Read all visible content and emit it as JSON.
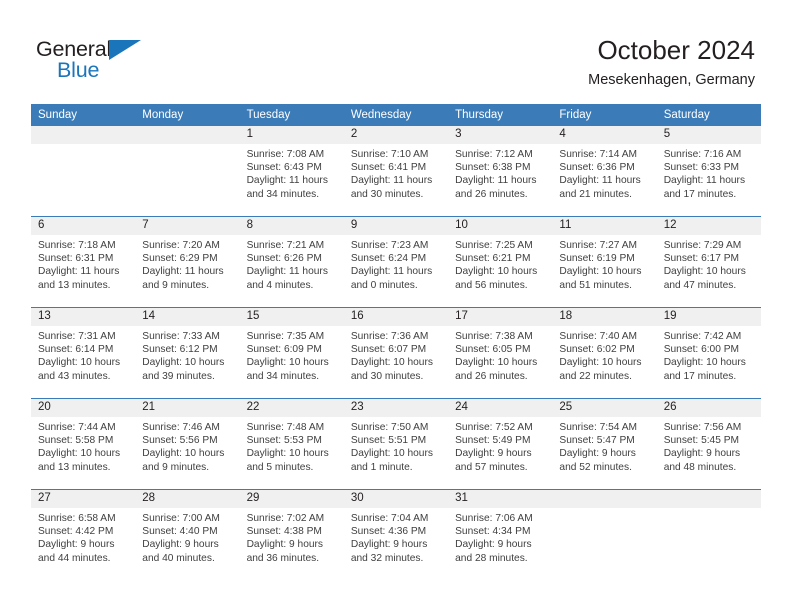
{
  "brand": {
    "line1": "General",
    "line2": "Blue",
    "triangle_icon": "blue-triangle-logo-mark",
    "color_dark": "#231f20",
    "color_blue": "#1b75bb"
  },
  "header": {
    "title": "October 2024",
    "subtitle": "Mesekenhagen, Germany"
  },
  "theme": {
    "header_bg": "#3b7cb8",
    "header_text": "#ffffff",
    "daynum_strip_bg": "#f0f0f0",
    "row_divider": "#3b7cb8",
    "body_text": "#404040"
  },
  "weekday_headers": [
    "Sunday",
    "Monday",
    "Tuesday",
    "Wednesday",
    "Thursday",
    "Friday",
    "Saturday"
  ],
  "weeks": [
    [
      {
        "date": "",
        "sunrise": "",
        "sunset": "",
        "daylight_line1": "",
        "daylight_line2": ""
      },
      {
        "date": "",
        "sunrise": "",
        "sunset": "",
        "daylight_line1": "",
        "daylight_line2": ""
      },
      {
        "date": "1",
        "sunrise": "Sunrise: 7:08 AM",
        "sunset": "Sunset: 6:43 PM",
        "daylight_line1": "Daylight: 11 hours",
        "daylight_line2": "and 34 minutes."
      },
      {
        "date": "2",
        "sunrise": "Sunrise: 7:10 AM",
        "sunset": "Sunset: 6:41 PM",
        "daylight_line1": "Daylight: 11 hours",
        "daylight_line2": "and 30 minutes."
      },
      {
        "date": "3",
        "sunrise": "Sunrise: 7:12 AM",
        "sunset": "Sunset: 6:38 PM",
        "daylight_line1": "Daylight: 11 hours",
        "daylight_line2": "and 26 minutes."
      },
      {
        "date": "4",
        "sunrise": "Sunrise: 7:14 AM",
        "sunset": "Sunset: 6:36 PM",
        "daylight_line1": "Daylight: 11 hours",
        "daylight_line2": "and 21 minutes."
      },
      {
        "date": "5",
        "sunrise": "Sunrise: 7:16 AM",
        "sunset": "Sunset: 6:33 PM",
        "daylight_line1": "Daylight: 11 hours",
        "daylight_line2": "and 17 minutes."
      }
    ],
    [
      {
        "date": "6",
        "sunrise": "Sunrise: 7:18 AM",
        "sunset": "Sunset: 6:31 PM",
        "daylight_line1": "Daylight: 11 hours",
        "daylight_line2": "and 13 minutes."
      },
      {
        "date": "7",
        "sunrise": "Sunrise: 7:20 AM",
        "sunset": "Sunset: 6:29 PM",
        "daylight_line1": "Daylight: 11 hours",
        "daylight_line2": "and 9 minutes."
      },
      {
        "date": "8",
        "sunrise": "Sunrise: 7:21 AM",
        "sunset": "Sunset: 6:26 PM",
        "daylight_line1": "Daylight: 11 hours",
        "daylight_line2": "and 4 minutes."
      },
      {
        "date": "9",
        "sunrise": "Sunrise: 7:23 AM",
        "sunset": "Sunset: 6:24 PM",
        "daylight_line1": "Daylight: 11 hours",
        "daylight_line2": "and 0 minutes."
      },
      {
        "date": "10",
        "sunrise": "Sunrise: 7:25 AM",
        "sunset": "Sunset: 6:21 PM",
        "daylight_line1": "Daylight: 10 hours",
        "daylight_line2": "and 56 minutes."
      },
      {
        "date": "11",
        "sunrise": "Sunrise: 7:27 AM",
        "sunset": "Sunset: 6:19 PM",
        "daylight_line1": "Daylight: 10 hours",
        "daylight_line2": "and 51 minutes."
      },
      {
        "date": "12",
        "sunrise": "Sunrise: 7:29 AM",
        "sunset": "Sunset: 6:17 PM",
        "daylight_line1": "Daylight: 10 hours",
        "daylight_line2": "and 47 minutes."
      }
    ],
    [
      {
        "date": "13",
        "sunrise": "Sunrise: 7:31 AM",
        "sunset": "Sunset: 6:14 PM",
        "daylight_line1": "Daylight: 10 hours",
        "daylight_line2": "and 43 minutes."
      },
      {
        "date": "14",
        "sunrise": "Sunrise: 7:33 AM",
        "sunset": "Sunset: 6:12 PM",
        "daylight_line1": "Daylight: 10 hours",
        "daylight_line2": "and 39 minutes."
      },
      {
        "date": "15",
        "sunrise": "Sunrise: 7:35 AM",
        "sunset": "Sunset: 6:09 PM",
        "daylight_line1": "Daylight: 10 hours",
        "daylight_line2": "and 34 minutes."
      },
      {
        "date": "16",
        "sunrise": "Sunrise: 7:36 AM",
        "sunset": "Sunset: 6:07 PM",
        "daylight_line1": "Daylight: 10 hours",
        "daylight_line2": "and 30 minutes."
      },
      {
        "date": "17",
        "sunrise": "Sunrise: 7:38 AM",
        "sunset": "Sunset: 6:05 PM",
        "daylight_line1": "Daylight: 10 hours",
        "daylight_line2": "and 26 minutes."
      },
      {
        "date": "18",
        "sunrise": "Sunrise: 7:40 AM",
        "sunset": "Sunset: 6:02 PM",
        "daylight_line1": "Daylight: 10 hours",
        "daylight_line2": "and 22 minutes."
      },
      {
        "date": "19",
        "sunrise": "Sunrise: 7:42 AM",
        "sunset": "Sunset: 6:00 PM",
        "daylight_line1": "Daylight: 10 hours",
        "daylight_line2": "and 17 minutes."
      }
    ],
    [
      {
        "date": "20",
        "sunrise": "Sunrise: 7:44 AM",
        "sunset": "Sunset: 5:58 PM",
        "daylight_line1": "Daylight: 10 hours",
        "daylight_line2": "and 13 minutes."
      },
      {
        "date": "21",
        "sunrise": "Sunrise: 7:46 AM",
        "sunset": "Sunset: 5:56 PM",
        "daylight_line1": "Daylight: 10 hours",
        "daylight_line2": "and 9 minutes."
      },
      {
        "date": "22",
        "sunrise": "Sunrise: 7:48 AM",
        "sunset": "Sunset: 5:53 PM",
        "daylight_line1": "Daylight: 10 hours",
        "daylight_line2": "and 5 minutes."
      },
      {
        "date": "23",
        "sunrise": "Sunrise: 7:50 AM",
        "sunset": "Sunset: 5:51 PM",
        "daylight_line1": "Daylight: 10 hours",
        "daylight_line2": "and 1 minute."
      },
      {
        "date": "24",
        "sunrise": "Sunrise: 7:52 AM",
        "sunset": "Sunset: 5:49 PM",
        "daylight_line1": "Daylight: 9 hours",
        "daylight_line2": "and 57 minutes."
      },
      {
        "date": "25",
        "sunrise": "Sunrise: 7:54 AM",
        "sunset": "Sunset: 5:47 PM",
        "daylight_line1": "Daylight: 9 hours",
        "daylight_line2": "and 52 minutes."
      },
      {
        "date": "26",
        "sunrise": "Sunrise: 7:56 AM",
        "sunset": "Sunset: 5:45 PM",
        "daylight_line1": "Daylight: 9 hours",
        "daylight_line2": "and 48 minutes."
      }
    ],
    [
      {
        "date": "27",
        "sunrise": "Sunrise: 6:58 AM",
        "sunset": "Sunset: 4:42 PM",
        "daylight_line1": "Daylight: 9 hours",
        "daylight_line2": "and 44 minutes."
      },
      {
        "date": "28",
        "sunrise": "Sunrise: 7:00 AM",
        "sunset": "Sunset: 4:40 PM",
        "daylight_line1": "Daylight: 9 hours",
        "daylight_line2": "and 40 minutes."
      },
      {
        "date": "29",
        "sunrise": "Sunrise: 7:02 AM",
        "sunset": "Sunset: 4:38 PM",
        "daylight_line1": "Daylight: 9 hours",
        "daylight_line2": "and 36 minutes."
      },
      {
        "date": "30",
        "sunrise": "Sunrise: 7:04 AM",
        "sunset": "Sunset: 4:36 PM",
        "daylight_line1": "Daylight: 9 hours",
        "daylight_line2": "and 32 minutes."
      },
      {
        "date": "31",
        "sunrise": "Sunrise: 7:06 AM",
        "sunset": "Sunset: 4:34 PM",
        "daylight_line1": "Daylight: 9 hours",
        "daylight_line2": "and 28 minutes."
      },
      {
        "date": "",
        "sunrise": "",
        "sunset": "",
        "daylight_line1": "",
        "daylight_line2": ""
      },
      {
        "date": "",
        "sunrise": "",
        "sunset": "",
        "daylight_line1": "",
        "daylight_line2": ""
      }
    ]
  ]
}
